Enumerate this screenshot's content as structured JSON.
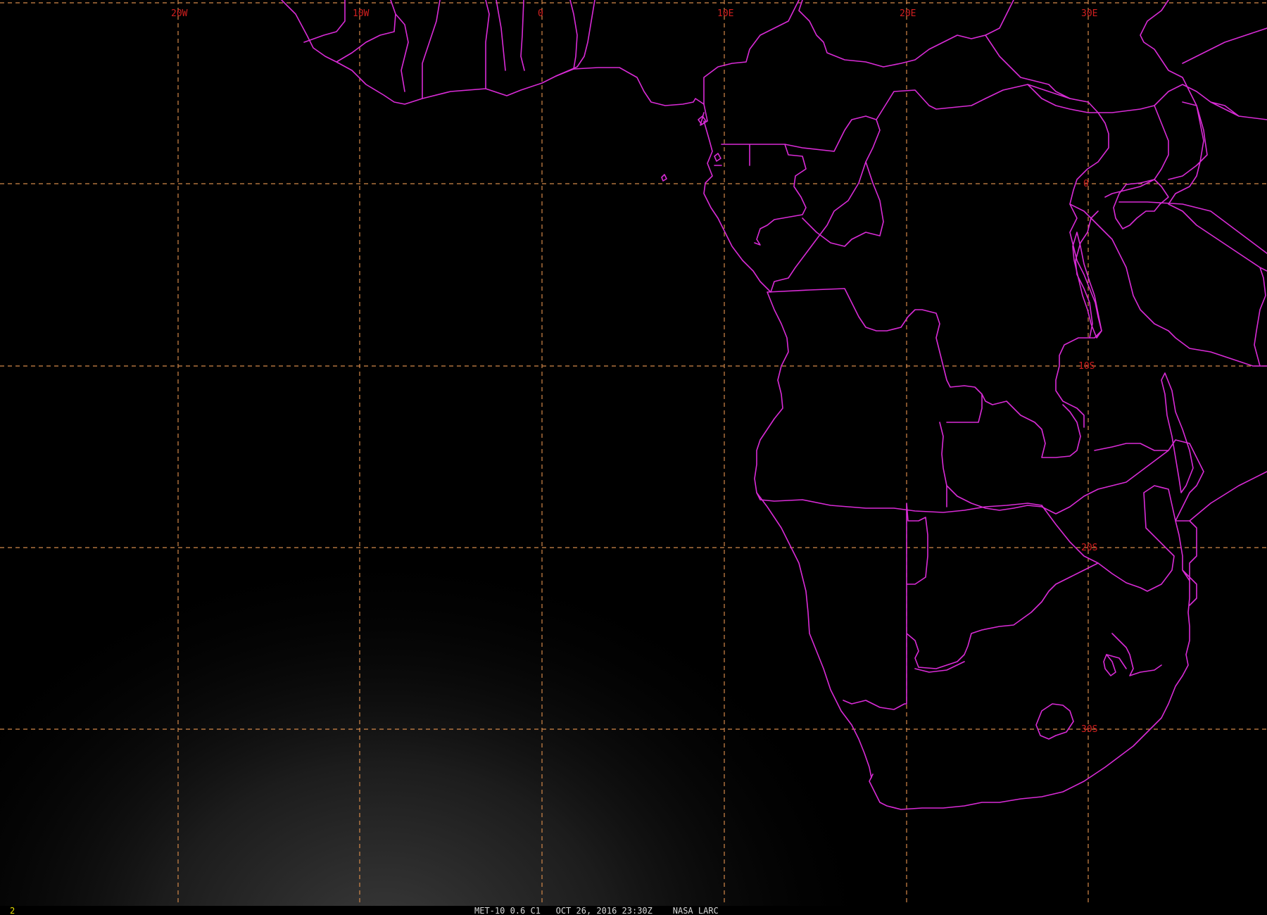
{
  "map": {
    "longitude_labels": [
      "20W",
      "10W",
      "0",
      "10E",
      "20E",
      "30E"
    ],
    "latitude_labels": [
      "0",
      "10S",
      "20S",
      "30S"
    ],
    "colors": {
      "background": "#000000",
      "grid": "#d4894a",
      "grid_labels": "#d21f1f",
      "borders": "#d92bd6"
    }
  },
  "footer": {
    "frame_number": "2",
    "caption": "MET-10 0.6 C1   OCT 26, 2016 23:30Z    NASA LARC"
  }
}
